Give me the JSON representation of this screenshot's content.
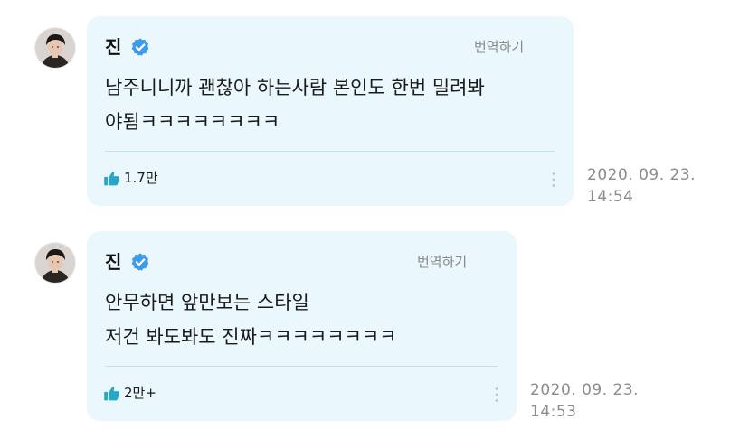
{
  "posts": [
    {
      "author": "진",
      "translate_label": "번역하기",
      "text_lines": [
        "남주니니까 괜찮아 하는사람 본인도 한번 밀려봐",
        "야됨ㅋㅋㅋㅋㅋㅋㅋㅋ"
      ],
      "like_count": "1.7만",
      "date": "2020. 09. 23.",
      "time": "14:54"
    },
    {
      "author": "진",
      "translate_label": "번역하기",
      "text_lines": [
        "안무하면 앞만보는 스타일",
        "저건 봐도봐도 진짜ㅋㅋㅋㅋㅋㅋㅋㅋ"
      ],
      "like_count": "2만+",
      "date": "2020. 09. 23.",
      "time": "14:53"
    }
  ],
  "colors": {
    "bubble_bg": "#eaf7fd",
    "divider": "#bfe2ee",
    "verified_badge": "#3d9be9",
    "like_icon": "#28a8c8",
    "meta_text": "#8c8c8c"
  },
  "icons": {
    "verified": "verified-badge-icon",
    "like": "thumbs-up-icon",
    "more": "more-vertical-icon"
  }
}
